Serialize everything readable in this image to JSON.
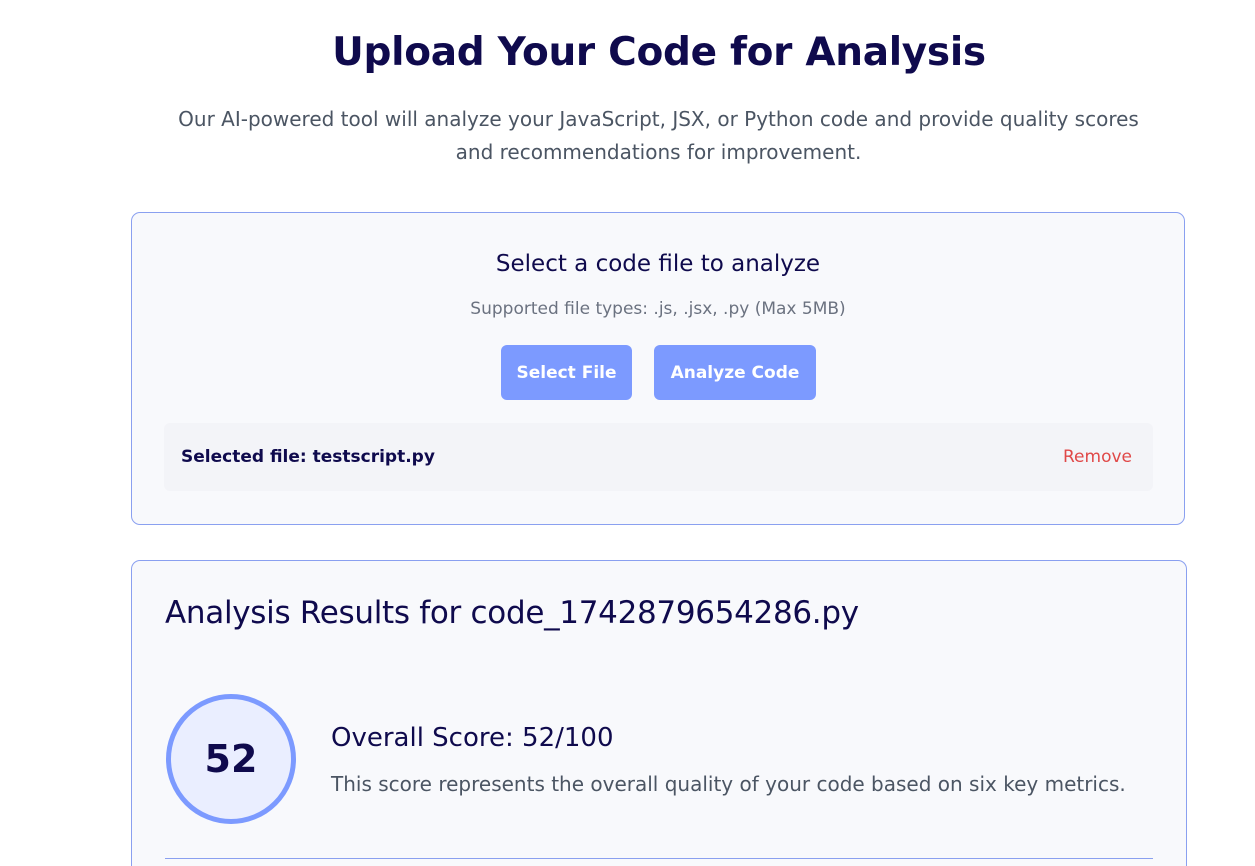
{
  "header": {
    "title": "Upload Your Code for Analysis",
    "subtitle": "Our AI-powered tool will analyze your JavaScript, JSX, or Python code and provide quality scores and recommendations for improvement."
  },
  "upload": {
    "title": "Select a code file to analyze",
    "hint": "Supported file types: .js, .jsx, .py (Max 5MB)",
    "select_button": "Select File",
    "analyze_button": "Analyze Code",
    "selected_file_label": "Selected file: testscript.py",
    "remove_label": "Remove"
  },
  "results": {
    "title": "Analysis Results for code_1742879654286.py",
    "score_value": "52",
    "score_heading": "Overall Score: 52/100",
    "score_description": "This score represents the overall quality of your code based on six key metrics."
  },
  "colors": {
    "heading": "#0f0a4d",
    "accent": "#7c9aff",
    "danger": "#e04848",
    "border": "#8aa0f0"
  }
}
